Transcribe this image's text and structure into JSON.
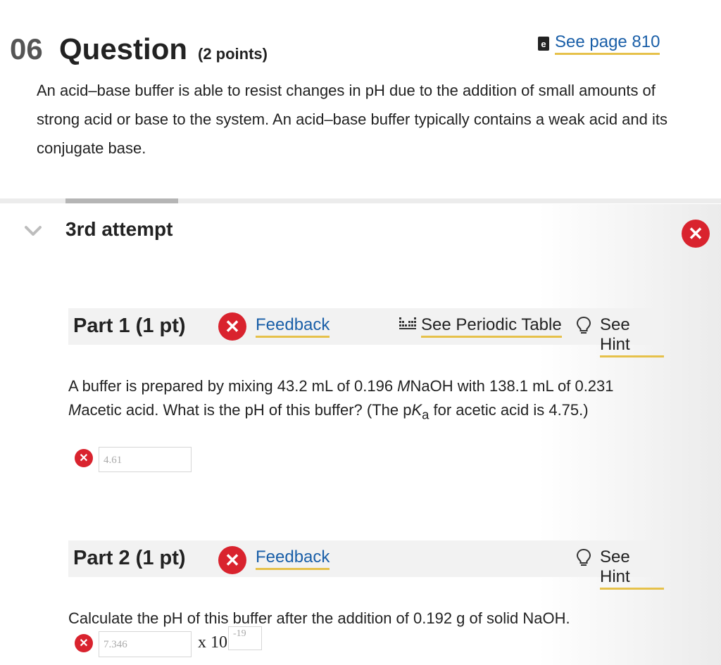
{
  "header": {
    "number": "06",
    "title": "Question",
    "points": "(2 points)",
    "see_page": "See page 810",
    "book_icon": "book-icon"
  },
  "intro": "An acid–base buffer is able to resist changes in pH due to the addition of small amounts of strong acid or base to the system. An acid–base buffer typically contains a weak acid and its conjugate base.",
  "attempt": {
    "label": "3rd attempt",
    "status_icon": "x-circle-icon"
  },
  "parts": [
    {
      "title": "Part 1 (1 pt)",
      "feedback": "Feedback",
      "periodic": "See Periodic Table",
      "hint": "See Hint",
      "question": {
        "t1": "A buffer is prepared by mixing 43.2 mL of 0.196 ",
        "m1": "M",
        "t2": "NaOH with 138.1 mL of 0.231 ",
        "m2": "M",
        "t3": "acetic acid. What is the pH of this buffer? (The p",
        "k": "K",
        "sub": "a",
        "t4": " for acetic acid is 4.75.)"
      },
      "answer": "4.61"
    },
    {
      "title": "Part 2 (1 pt)",
      "feedback": "Feedback",
      "hint": "See Hint",
      "question": "Calculate the pH of this buffer after the addition of 0.192 g of solid NaOH.",
      "answer": "7.346",
      "times10": "x 10",
      "exponent": "-19"
    }
  ],
  "colors": {
    "error_red": "#d9232e",
    "link_blue": "#1a5fa8",
    "underline_gold": "#e6c14a"
  }
}
